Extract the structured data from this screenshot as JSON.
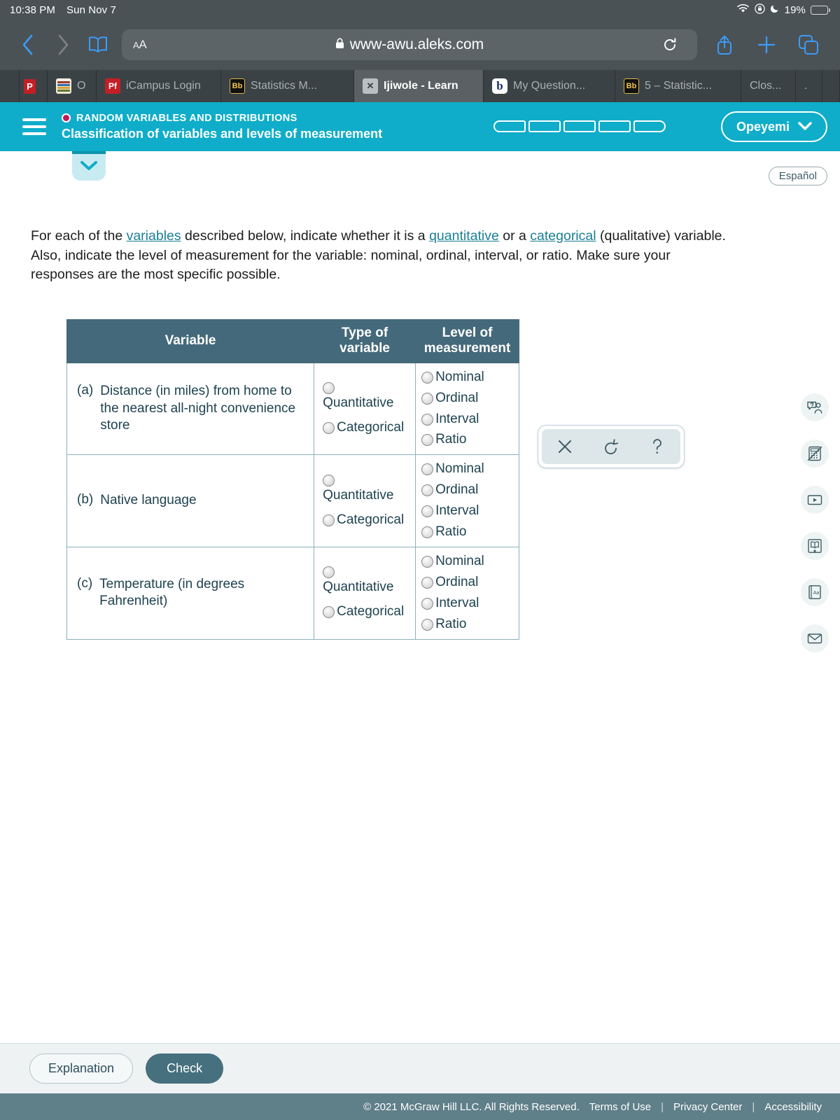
{
  "status_bar": {
    "time": "10:38 PM",
    "date": "Sun Nov 7",
    "battery_percent": "19%",
    "icons": [
      "wifi-icon",
      "rotation-lock-icon",
      "moon-icon",
      "battery-icon"
    ]
  },
  "browser": {
    "url": "www-awu.aleks.com",
    "text_size_label": "AA",
    "back_icon": "chevron-left-icon",
    "forward_icon": "chevron-right-icon",
    "bookmarks_icon": "book-icon",
    "lock_icon": "lock-icon",
    "reload_icon": "reload-icon",
    "share_icon": "share-icon",
    "new_tab_icon": "plus-icon",
    "tabs_icon": "tabs-icon",
    "tabs": [
      {
        "label": "",
        "favicon": "pdf-icon",
        "active": false
      },
      {
        "label": "O",
        "favicon": "books-icon",
        "active": false
      },
      {
        "label": "iCampus Login",
        "favicon": "pf-icon",
        "active": false
      },
      {
        "label": "Statistics M...",
        "favicon": "blackboard-icon",
        "active": false
      },
      {
        "label": "Ijiwole - Learn",
        "favicon": "x-icon",
        "active": true
      },
      {
        "label": "My Question...",
        "favicon": "bartleby-icon",
        "active": false
      },
      {
        "label": "5 – Statistic...",
        "favicon": "blackboard-icon",
        "active": false
      },
      {
        "label": "Clos...",
        "favicon": "",
        "active": false
      },
      {
        "label": ".",
        "favicon": "",
        "active": false
      }
    ]
  },
  "aleks_header": {
    "menu_icon": "hamburger-icon",
    "topic": "RANDOM VARIABLES AND DISTRIBUTIONS",
    "lesson": "Classification of variables and levels of measurement",
    "progress_segments": 5,
    "user_name": "Opeyemi",
    "user_caret_icon": "chevron-down-icon",
    "accent_color": "#0fadc9",
    "topic_dot_color": "#c2185b"
  },
  "page": {
    "collapse_icon": "chevron-down-icon",
    "espanol_label": "Español",
    "prompt": {
      "part1": "For each of the ",
      "link1": "variables",
      "part2": " described below, indicate whether it is a ",
      "link2": "quantitative",
      "part3": " or a ",
      "link3": "categorical",
      "part4": " (qualitative) variable. Also, indicate the level of measurement for the variable: nominal, ordinal, interval, or ratio. Make sure your responses are the most specific possible."
    }
  },
  "table": {
    "headers": {
      "variable": "Variable",
      "type_line1": "Type of",
      "type_line2": "variable",
      "level_line1": "Level of",
      "level_line2": "measurement"
    },
    "type_options": [
      "Quantitative",
      "Categorical"
    ],
    "level_options": [
      "Nominal",
      "Ordinal",
      "Interval",
      "Ratio"
    ],
    "rows": [
      {
        "letter": "(a)",
        "text": "Distance (in miles) from home to the nearest all-night convenience store",
        "type_selected": null,
        "level_selected": null
      },
      {
        "letter": "(b)",
        "text": "Native language",
        "type_selected": null,
        "level_selected": null
      },
      {
        "letter": "(c)",
        "text": "Temperature (in degrees Fahrenheit)",
        "type_selected": null,
        "level_selected": null
      }
    ]
  },
  "palette": {
    "clear_icon": "x-icon",
    "undo_icon": "undo-icon",
    "help_icon": "question-mark-icon"
  },
  "rail": {
    "items": [
      {
        "icon": "ask-tutor-icon"
      },
      {
        "icon": "calculator-disabled-icon"
      },
      {
        "icon": "video-icon"
      },
      {
        "icon": "ebook-icon"
      },
      {
        "icon": "dictionary-icon"
      },
      {
        "icon": "message-icon"
      }
    ]
  },
  "footer": {
    "explanation_label": "Explanation",
    "check_label": "Check",
    "copyright": "© 2021 McGraw Hill LLC. All Rights Reserved.",
    "links": [
      "Terms of Use",
      "Privacy Center",
      "Accessibility"
    ],
    "separator": "|"
  }
}
